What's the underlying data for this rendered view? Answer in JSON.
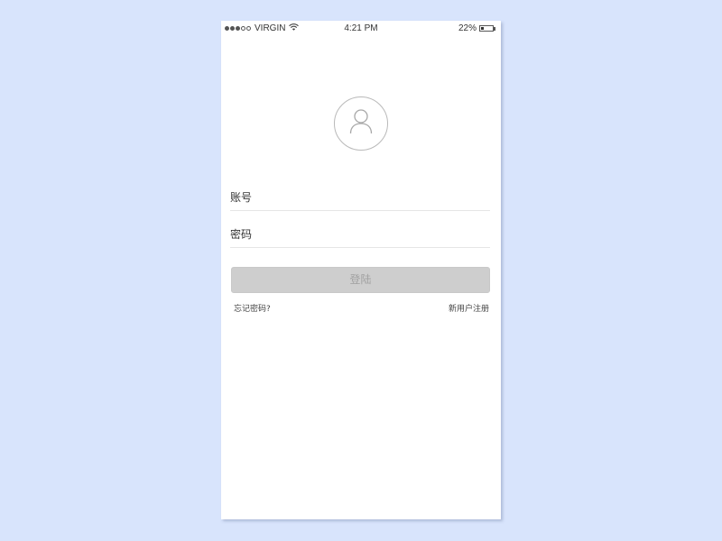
{
  "status_bar": {
    "signal_filled": 3,
    "signal_total": 5,
    "carrier": "VIRGIN",
    "time": "4:21 PM",
    "battery_text": "22%",
    "battery_level": 0.22
  },
  "form": {
    "account_placeholder": "账号",
    "password_placeholder": "密码",
    "login_label": "登陆"
  },
  "links": {
    "forgot_password": "忘记密码?",
    "register": "新用户注册"
  },
  "icons": {
    "avatar": "user-icon",
    "wifi": "wifi-icon",
    "battery": "battery-icon"
  },
  "colors": {
    "page_background": "#d8e4fc",
    "button_text": "#a2a2a2"
  }
}
